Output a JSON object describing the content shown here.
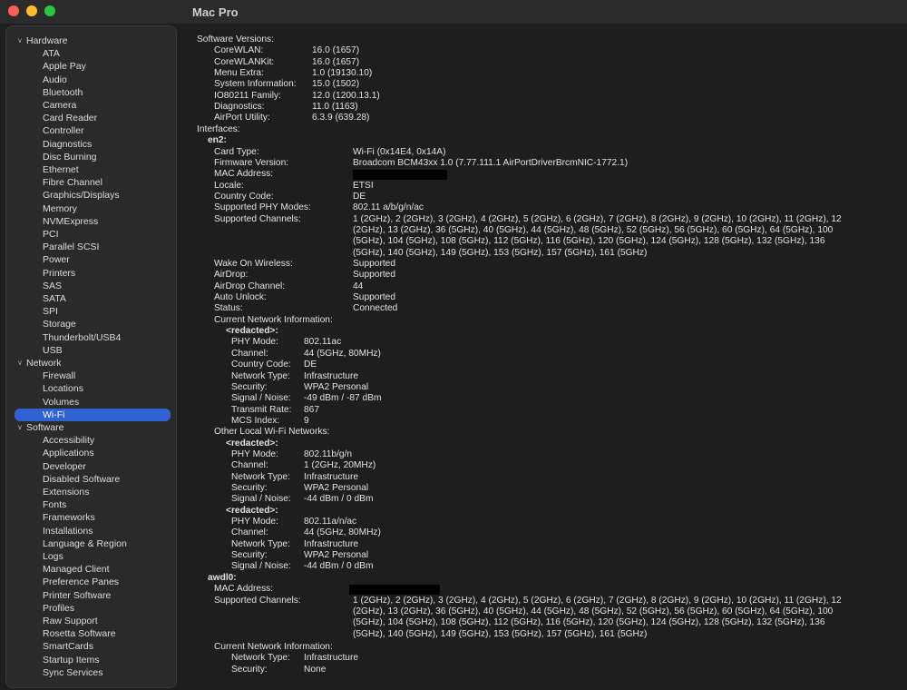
{
  "window": {
    "title": "Mac Pro"
  },
  "sidebar": {
    "groups": [
      {
        "label": "Hardware",
        "items": [
          "ATA",
          "Apple Pay",
          "Audio",
          "Bluetooth",
          "Camera",
          "Card Reader",
          "Controller",
          "Diagnostics",
          "Disc Burning",
          "Ethernet",
          "Fibre Channel",
          "Graphics/Displays",
          "Memory",
          "NVMExpress",
          "PCI",
          "Parallel SCSI",
          "Power",
          "Printers",
          "SAS",
          "SATA",
          "SPI",
          "Storage",
          "Thunderbolt/USB4",
          "USB"
        ]
      },
      {
        "label": "Network",
        "items": [
          "Firewall",
          "Locations",
          "Volumes",
          "Wi-Fi"
        ]
      },
      {
        "label": "Software",
        "items": [
          "Accessibility",
          "Applications",
          "Developer",
          "Disabled Software",
          "Extensions",
          "Fonts",
          "Frameworks",
          "Installations",
          "Language & Region",
          "Logs",
          "Managed Client",
          "Preference Panes",
          "Printer Software",
          "Profiles",
          "Raw Support",
          "Rosetta Software",
          "SmartCards",
          "Startup Items",
          "Sync Services"
        ]
      }
    ],
    "selected": "Wi-Fi"
  },
  "content": {
    "software_versions_heading": "Software Versions:",
    "software_versions": [
      {
        "k": "CoreWLAN:",
        "v": "16.0 (1657)"
      },
      {
        "k": "CoreWLANKit:",
        "v": "16.0 (1657)"
      },
      {
        "k": "Menu Extra:",
        "v": "1.0 (19130.10)"
      },
      {
        "k": "System Information:",
        "v": "15.0 (1502)"
      },
      {
        "k": "IO80211 Family:",
        "v": "12.0 (1200.13.1)"
      },
      {
        "k": "Diagnostics:",
        "v": "11.0 (1163)"
      },
      {
        "k": "AirPort Utility:",
        "v": "6.3.9 (639.28)"
      }
    ],
    "interfaces_heading": "Interfaces:",
    "en2": {
      "name": "en2:",
      "card_type_k": "Card Type:",
      "card_type_v": "Wi-Fi  (0x14E4, 0x14A)",
      "firmware_k": "Firmware Version:",
      "firmware_v": "Broadcom BCM43xx 1.0 (7.77.111.1 AirPortDriverBrcmNIC-1772.1)",
      "mac_k": "MAC Address:",
      "locale_k": "Locale:",
      "locale_v": "ETSI",
      "country_k": "Country Code:",
      "country_v": "DE",
      "phy_k": "Supported PHY Modes:",
      "phy_v": "802.11 a/b/g/n/ac",
      "channels_k": "Supported Channels:",
      "channels_lines": [
        "1 (2GHz), 2 (2GHz), 3 (2GHz), 4 (2GHz), 5 (2GHz), 6 (2GHz), 7 (2GHz), 8 (2GHz), 9 (2GHz), 10 (2GHz), 11 (2GHz), 12",
        "(2GHz), 13 (2GHz), 36 (5GHz), 40 (5GHz), 44 (5GHz), 48 (5GHz), 52 (5GHz), 56 (5GHz), 60 (5GHz), 64 (5GHz), 100",
        "(5GHz), 104 (5GHz), 108 (5GHz), 112 (5GHz), 116 (5GHz), 120 (5GHz), 124 (5GHz), 128 (5GHz), 132 (5GHz), 136",
        "(5GHz), 140 (5GHz), 149 (5GHz), 153 (5GHz), 157 (5GHz), 161 (5GHz)"
      ],
      "wake_k": "Wake On Wireless:",
      "wake_v": "Supported",
      "airdrop_k": "AirDrop:",
      "airdrop_v": "Supported",
      "airdrop_ch_k": "AirDrop Channel:",
      "airdrop_ch_v": "44",
      "unlock_k": "Auto Unlock:",
      "unlock_v": "Supported",
      "status_k": "Status:",
      "status_v": "Connected",
      "current_heading": "Current Network Information:",
      "current": {
        "name": "<redacted>:",
        "rows": [
          {
            "k": "PHY Mode:",
            "v": "802.11ac"
          },
          {
            "k": "Channel:",
            "v": "44 (5GHz, 80MHz)"
          },
          {
            "k": "Country Code:",
            "v": "DE"
          },
          {
            "k": "Network Type:",
            "v": "Infrastructure"
          },
          {
            "k": "Security:",
            "v": "WPA2 Personal"
          },
          {
            "k": "Signal / Noise:",
            "v": "-49 dBm / -87 dBm"
          },
          {
            "k": "Transmit Rate:",
            "v": "867"
          },
          {
            "k": "MCS Index:",
            "v": "9"
          }
        ]
      },
      "other_heading": "Other Local Wi-Fi Networks:",
      "others": [
        {
          "name": "<redacted>:",
          "rows": [
            {
              "k": "PHY Mode:",
              "v": "802.11b/g/n"
            },
            {
              "k": "Channel:",
              "v": "1 (2GHz, 20MHz)"
            },
            {
              "k": "Network Type:",
              "v": "Infrastructure"
            },
            {
              "k": "Security:",
              "v": "WPA2 Personal"
            },
            {
              "k": "Signal / Noise:",
              "v": "-44 dBm / 0 dBm"
            }
          ]
        },
        {
          "name": "<redacted>:",
          "rows": [
            {
              "k": "PHY Mode:",
              "v": "802.11a/n/ac"
            },
            {
              "k": "Channel:",
              "v": "44 (5GHz, 80MHz)"
            },
            {
              "k": "Network Type:",
              "v": "Infrastructure"
            },
            {
              "k": "Security:",
              "v": "WPA2 Personal"
            },
            {
              "k": "Signal / Noise:",
              "v": "-44 dBm / 0 dBm"
            }
          ]
        }
      ]
    },
    "awdl0": {
      "name": "awdl0:",
      "mac_k": "MAC Address:",
      "channels_k": "Supported Channels:",
      "channels_lines": [
        "1 (2GHz), 2 (2GHz), 3 (2GHz), 4 (2GHz), 5 (2GHz), 6 (2GHz), 7 (2GHz), 8 (2GHz), 9 (2GHz), 10 (2GHz), 11 (2GHz), 12",
        "(2GHz), 13 (2GHz), 36 (5GHz), 40 (5GHz), 44 (5GHz), 48 (5GHz), 52 (5GHz), 56 (5GHz), 60 (5GHz), 64 (5GHz), 100",
        "(5GHz), 104 (5GHz), 108 (5GHz), 112 (5GHz), 116 (5GHz), 120 (5GHz), 124 (5GHz), 128 (5GHz), 132 (5GHz), 136",
        "(5GHz), 140 (5GHz), 149 (5GHz), 153 (5GHz), 157 (5GHz), 161 (5GHz)"
      ],
      "current_heading": "Current Network Information:",
      "rows": [
        {
          "k": "Network Type:",
          "v": "Infrastructure"
        },
        {
          "k": "Security:",
          "v": "None"
        }
      ]
    }
  }
}
